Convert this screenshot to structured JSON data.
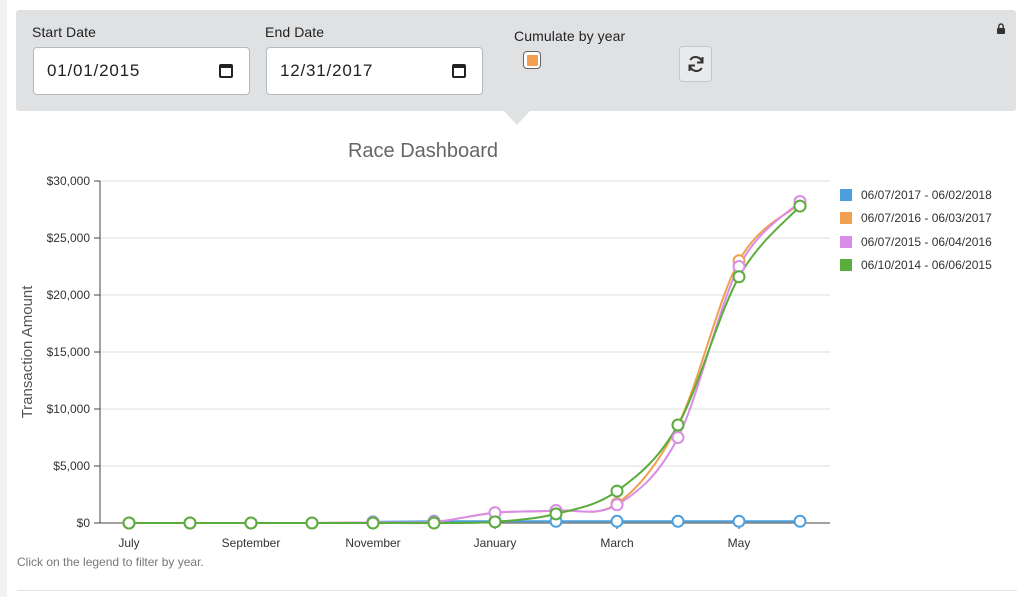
{
  "filters": {
    "start_date": {
      "label": "Start Date",
      "value": "01/01/2015"
    },
    "end_date": {
      "label": "End Date",
      "value": "12/31/2017"
    },
    "cumulate": {
      "label": "Cumulate by year",
      "checked": true
    }
  },
  "icons": {
    "calendar": "calendar-icon",
    "refresh": "refresh-icon",
    "lock": "lock-icon"
  },
  "footnote": "Click on the legend to filter by year.",
  "chart_data": {
    "type": "line",
    "title": "Race Dashboard",
    "ylabel": "Transaction Amount",
    "xlabel": "",
    "ylim": [
      0,
      30000
    ],
    "yticks": [
      "$0",
      "$5,000",
      "$10,000",
      "$15,000",
      "$20,000",
      "$25,000",
      "$30,000"
    ],
    "xticks": [
      "July",
      "September",
      "November",
      "January",
      "March",
      "May"
    ],
    "x_index_of_ticks": [
      0,
      2,
      4,
      6,
      8,
      10
    ],
    "grid": true,
    "legend_position": "right",
    "series": [
      {
        "name": "06/07/2017 - 06/02/2018",
        "color": "#4a9fdc",
        "values": [
          null,
          null,
          null,
          null,
          100,
          150,
          150,
          150,
          150,
          150,
          150,
          150
        ]
      },
      {
        "name": "06/07/2016 - 06/03/2017",
        "color": "#f0a050",
        "values": [
          0,
          0,
          0,
          0,
          50,
          100,
          900,
          1100,
          1700,
          8600,
          23000,
          28000
        ]
      },
      {
        "name": "06/07/2015 - 06/04/2016",
        "color": "#d98de8",
        "values": [
          0,
          0,
          0,
          0,
          50,
          100,
          900,
          1100,
          1600,
          7500,
          22500,
          28200
        ]
      },
      {
        "name": "06/10/2014 - 06/06/2015",
        "color": "#5aac3c",
        "values": [
          0,
          0,
          0,
          0,
          0,
          0,
          100,
          800,
          2800,
          8600,
          21600,
          27800
        ]
      }
    ]
  }
}
